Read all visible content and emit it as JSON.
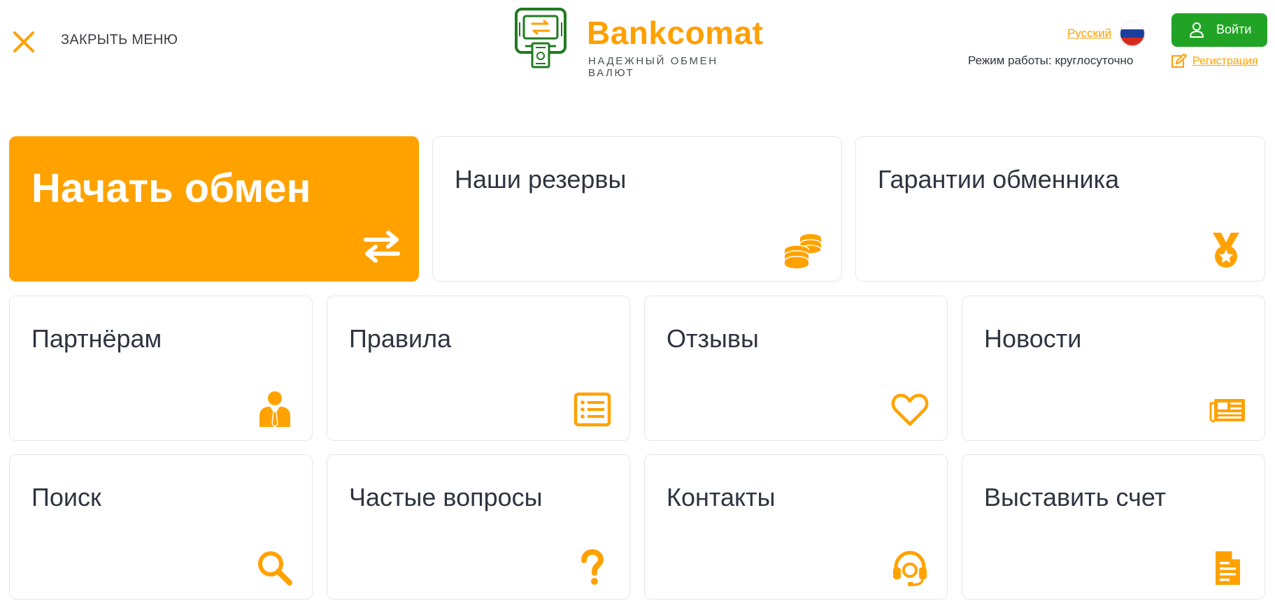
{
  "header": {
    "close_label": "ЗАКРЫТЬ МЕНЮ",
    "logo_name": "Bankcomat",
    "logo_tagline": "НАДЕЖНЫЙ ОБМЕН ВАЛЮТ",
    "language": "Русский",
    "working_hours": "Режим работы: круглосуточно",
    "login_label": "Войти",
    "register_label": "Регистрация"
  },
  "tiles": [
    {
      "label": "Начать обмен",
      "icon": "exchange-arrows-icon"
    },
    {
      "label": "Наши резервы",
      "icon": "coins-icon"
    },
    {
      "label": "Гарантии обменника",
      "icon": "medal-icon"
    },
    {
      "label": "Партнёрам",
      "icon": "partner-person-icon"
    },
    {
      "label": "Правила",
      "icon": "rules-list-icon"
    },
    {
      "label": "Отзывы",
      "icon": "heart-icon"
    },
    {
      "label": "Новости",
      "icon": "newspaper-icon"
    },
    {
      "label": "Поиск",
      "icon": "search-icon"
    },
    {
      "label": "Частые вопросы",
      "icon": "question-icon"
    },
    {
      "label": "Контакты",
      "icon": "headset-icon"
    },
    {
      "label": "Выставить счет",
      "icon": "invoice-icon"
    }
  ],
  "colors": {
    "accent": "#ffa200",
    "login_button": "#21a325",
    "text": "#2e3440",
    "tile_border": "#e4e6ea"
  }
}
